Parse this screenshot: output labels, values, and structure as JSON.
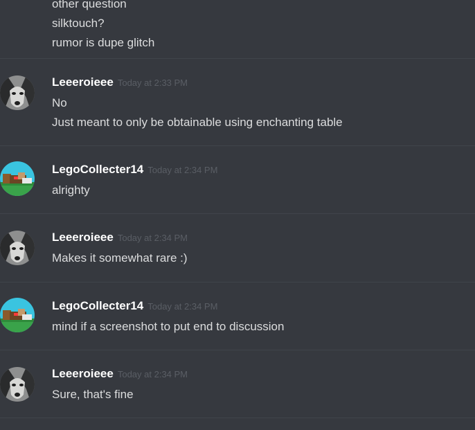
{
  "top_lines": [
    "other question",
    "silktouch?",
    "rumor is dupe glitch"
  ],
  "messages": [
    {
      "author": "Leeeroieee",
      "avatar": "husky-avatar",
      "timestamp": "Today at 2:33 PM",
      "lines": [
        "No",
        "Just meant to only be obtainable using enchanting table"
      ]
    },
    {
      "author": "LegoCollecter14",
      "avatar": "lego-avatar",
      "timestamp": "Today at 2:34 PM",
      "lines": [
        "alrighty"
      ]
    },
    {
      "author": "Leeeroieee",
      "avatar": "husky-avatar",
      "timestamp": "Today at 2:34 PM",
      "lines": [
        "Makes it somewhat rare :)"
      ]
    },
    {
      "author": "LegoCollecter14",
      "avatar": "lego-avatar",
      "timestamp": "Today at 2:34 PM",
      "lines": [
        "mind if a screenshot to put end to discussion"
      ]
    },
    {
      "author": "Leeeroieee",
      "avatar": "husky-avatar",
      "timestamp": "Today at 2:34 PM",
      "lines": [
        "Sure, that's fine"
      ]
    }
  ],
  "colors": {
    "background": "#36393f",
    "username": "#ffffff",
    "message_text": "#dcddde",
    "timestamp": "#5a5e65",
    "divider": "#40444b"
  }
}
